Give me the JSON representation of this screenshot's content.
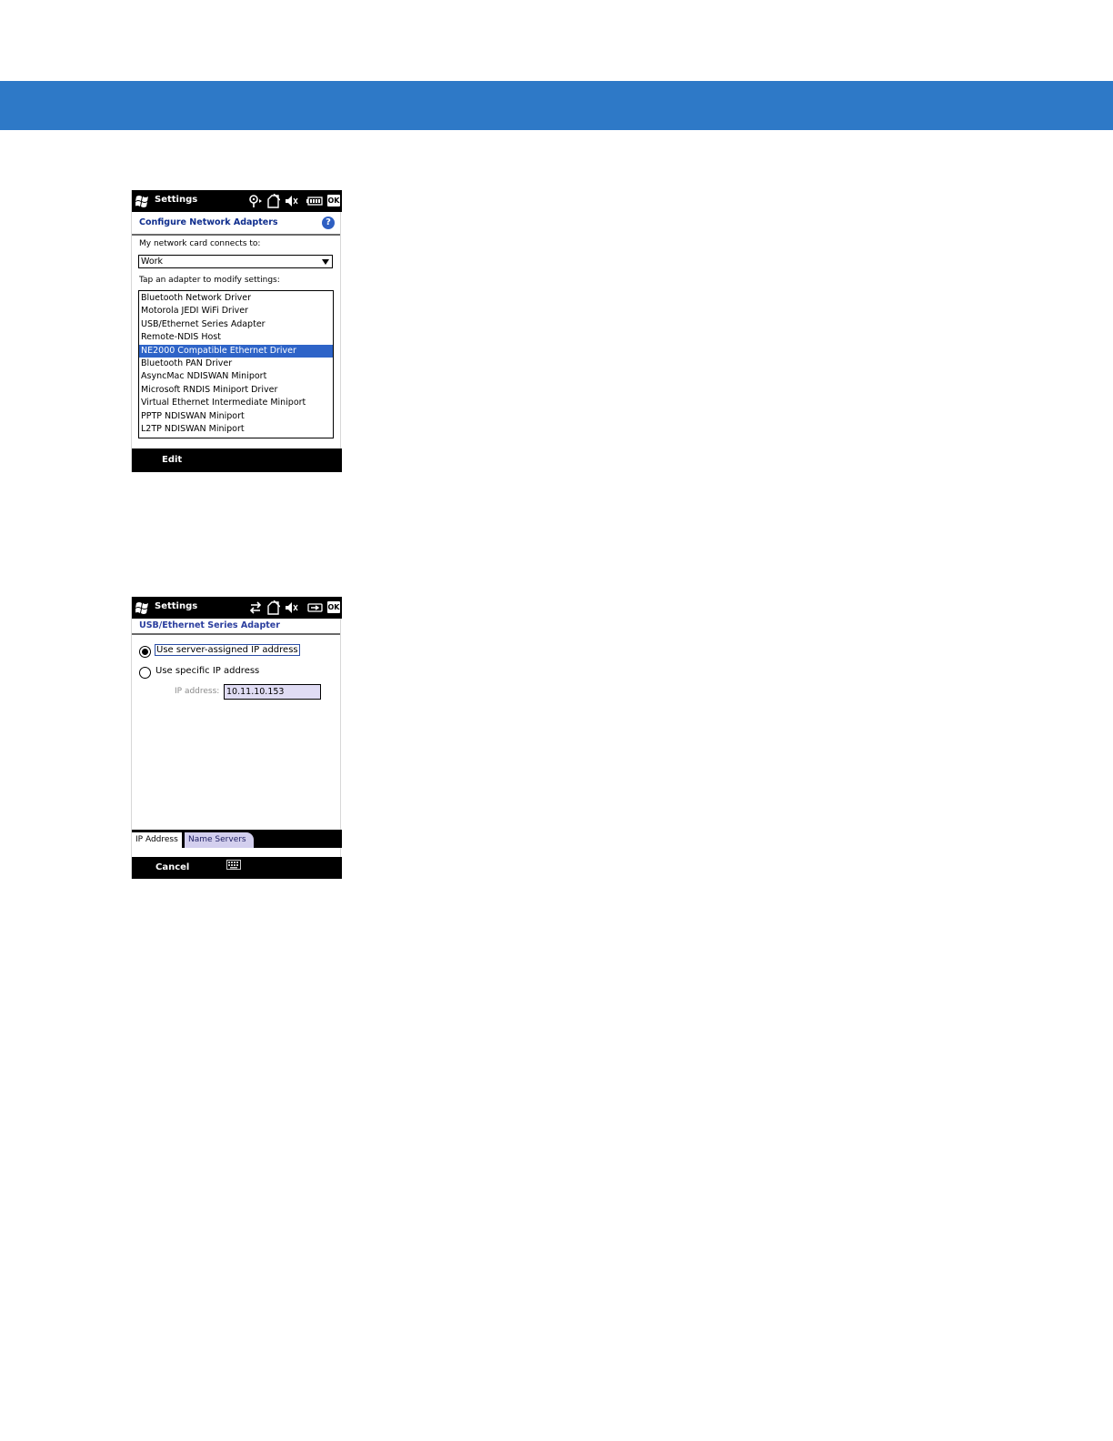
{
  "banner": {
    "color": "#2e79c7"
  },
  "screen1": {
    "titlebar": {
      "title": "Settings",
      "icons": [
        "windows-logo-icon",
        "wifi-signal-icon",
        "sync-icon",
        "speaker-mute-icon",
        "battery-icon"
      ],
      "ok": "OK"
    },
    "header": {
      "title": "Configure Network Adapters",
      "help": "?"
    },
    "connects_label": "My network card connects to:",
    "network_select": {
      "value": "Work"
    },
    "adapter_label": "Tap an adapter to modify settings:",
    "adapters": [
      {
        "label": "Bluetooth Network Driver",
        "selected": false
      },
      {
        "label": "Motorola JEDI WiFi Driver",
        "selected": false
      },
      {
        "label": "USB/Ethernet Series Adapter",
        "selected": false
      },
      {
        "label": "Remote-NDIS Host",
        "selected": false
      },
      {
        "label": "NE2000 Compatible Ethernet Driver",
        "selected": true
      },
      {
        "label": "Bluetooth PAN Driver",
        "selected": false
      },
      {
        "label": "AsyncMac NDISWAN Miniport",
        "selected": false
      },
      {
        "label": "Microsoft RNDIS Miniport Driver",
        "selected": false
      },
      {
        "label": "Virtual Ethernet Intermediate Miniport",
        "selected": false
      },
      {
        "label": "PPTP NDISWAN Miniport",
        "selected": false
      },
      {
        "label": "L2TP NDISWAN Miniport",
        "selected": false
      }
    ],
    "softkey_left": "Edit"
  },
  "screen2": {
    "titlebar": {
      "title": "Settings",
      "icons": [
        "windows-logo-icon",
        "data-transfer-icon",
        "sync-icon",
        "speaker-mute-icon",
        "charging-icon"
      ],
      "ok": "OK"
    },
    "header": {
      "title": "USB/Ethernet Series Adapter"
    },
    "radio_server": {
      "label": "Use server-assigned IP address",
      "checked": true
    },
    "radio_specific": {
      "label": "Use specific IP address",
      "checked": false
    },
    "ip_label": "IP address:",
    "ip_value": "10.11.10.153",
    "tabs": [
      {
        "label": "IP Address",
        "active": true
      },
      {
        "label": "Name Servers",
        "active": false
      }
    ],
    "softkey_left": "Cancel",
    "keyboard_icon": "keyboard-icon"
  }
}
